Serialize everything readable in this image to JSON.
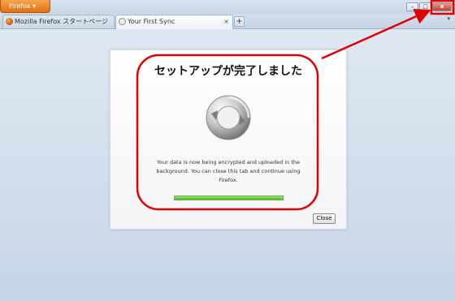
{
  "window": {
    "app_menu_label": "Firefox",
    "controls": {
      "minimize": "–",
      "maximize": "□",
      "close": "x"
    }
  },
  "tabs": [
    {
      "label": "Mozilla Firefox スタートページ",
      "active": false
    },
    {
      "label": "Your First Sync",
      "active": true
    }
  ],
  "tabbar": {
    "new_tab": "+",
    "tab_list": "▾",
    "tab_close": "×"
  },
  "dialog": {
    "title": "セットアップが完了しました",
    "message": "Your data is now being encrypted and uploaded in the background. You can close this tab and continue using Firefox.",
    "progress_fraction": 1.0,
    "close_label": "Close"
  },
  "icons": {
    "sync": "sync-icon",
    "firefox": "firefox-icon",
    "page": "page-icon"
  },
  "colors": {
    "annotation": "#e00000",
    "progress": "#3bbf1c",
    "app_menu": "#e46f12"
  }
}
